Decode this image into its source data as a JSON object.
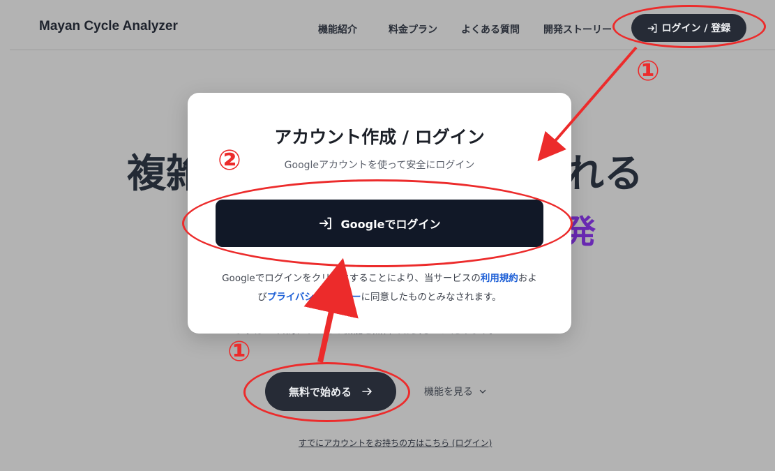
{
  "header": {
    "brand": "Mayan Cycle Analyzer",
    "nav": [
      "機能紹介",
      "料金プラン",
      "よくある質問",
      "開発ストーリー"
    ],
    "login_label": "ログイン / 登録"
  },
  "hero": {
    "title_left": "複雑",
    "title_right": "れる",
    "accent_fragment": "発",
    "description_fragment": "まずは20日間、すべての機能を無料でお試しいただけます。",
    "cta_label": "無料で始める",
    "features_label": "機能を見る",
    "signin_link": "すでにアカウントをお持ちの方はこちら (ログイン)"
  },
  "modal": {
    "title": "アカウント作成 / ログイン",
    "subtitle": "Googleアカウントを使って安全にログイン",
    "google_button": "Googleでログイン",
    "terms_prefix": "Googleでログインをクリックすることにより、当サービスの",
    "terms_link": "利用規約",
    "terms_mid_1": "およ",
    "terms_mid_2": "び",
    "privacy_link": "プライバシーポリシー",
    "terms_suffix": "に同意したものとみなされます。"
  },
  "annotations": {
    "step1_top": "①",
    "step2": "②",
    "step1_bottom": "①",
    "color": "#ec2b2b"
  },
  "icons": {
    "login": "arrow-into-bracket-icon",
    "arrow_right": "arrow-right-icon",
    "chevron": "chevron-down-icon"
  }
}
